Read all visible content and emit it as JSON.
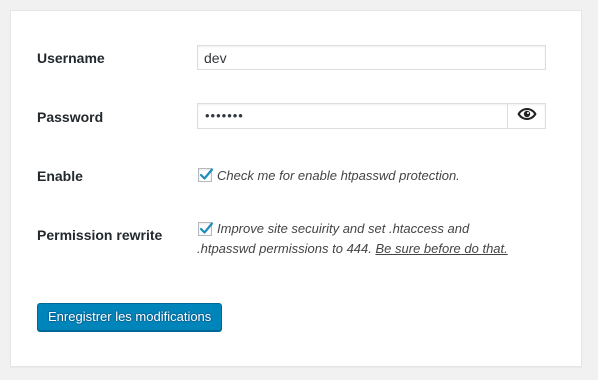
{
  "form": {
    "username": {
      "label": "Username",
      "value": "dev"
    },
    "password": {
      "label": "Password",
      "masked_value": "•••••••",
      "toggle_icon": "eye-icon"
    },
    "enable": {
      "label": "Enable",
      "checked": true,
      "description": "Check me for enable htpasswd protection."
    },
    "permission_rewrite": {
      "label": "Permission rewrite",
      "checked": true,
      "description_line1": "Improve site secuirity and set .htaccess and",
      "description_line2_prefix": ".htpasswd permissions to 444.",
      "description_line2_underlined": "Be sure before do that."
    },
    "save_label": "Enregistrer les modifications"
  },
  "colors": {
    "primary_button": "#0085ba",
    "checkmark": "#1e8cbe",
    "background": "#f1f1f1",
    "panel": "#ffffff"
  }
}
